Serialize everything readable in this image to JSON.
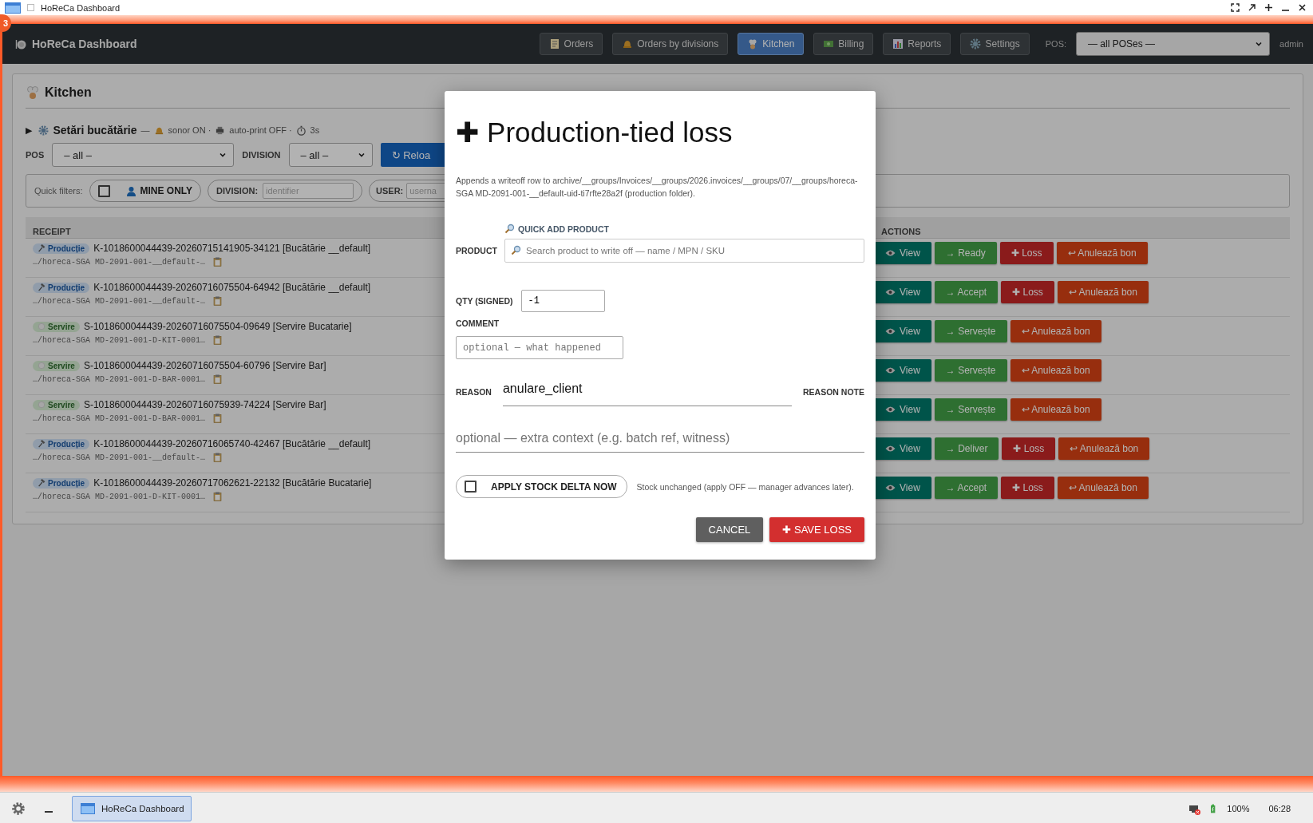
{
  "window": {
    "title": "HoReCa Dashboard",
    "badge": "3"
  },
  "header": {
    "title": "HoReCa Dashboard",
    "nav": [
      {
        "kind": "orders",
        "label": "Orders",
        "selected": false
      },
      {
        "kind": "divisions",
        "label": "Orders by divisions",
        "selected": false
      },
      {
        "kind": "kitchen",
        "label": "Kitchen",
        "selected": true
      },
      {
        "kind": "billing",
        "label": "Billing",
        "selected": false
      },
      {
        "kind": "reports",
        "label": "Reports",
        "selected": false
      },
      {
        "kind": "settings",
        "label": "Settings",
        "selected": false
      }
    ],
    "pos_label": "POS:",
    "pos_value": "— all POSes —",
    "user": "admin"
  },
  "kitchen": {
    "title": "Kitchen",
    "settings": {
      "toggle": "▶",
      "title": "Setări bucătărie",
      "separator": "—",
      "sound": "sonor ON ·",
      "autoprint": "auto-print OFF ·",
      "interval": "3s"
    },
    "filters": {
      "pos_label": "POS",
      "pos_value": "– all –",
      "division_label": "DIVISION",
      "division_value": "– all –",
      "reload": "↻ Reloa"
    },
    "quick_filters": {
      "label": "Quick filters:",
      "mine_only": {
        "label": "MINE ONLY",
        "checked": false
      },
      "division": {
        "label": "DIVISION:",
        "placeholder": "identifier"
      },
      "user": {
        "label": "USER:",
        "placeholder": "userna"
      }
    },
    "table": {
      "columns": [
        "RECEIPT",
        "ACTIONS"
      ],
      "rows": [
        {
          "badge": {
            "kind": "production",
            "label": "Producție"
          },
          "title": "K-1018600044439-20260715141905-34121 [Bucătărie __default]",
          "path": "…/horeca-SGA MD-2091-001-__default-…",
          "actions": [
            {
              "kind": "view",
              "label": "View"
            },
            {
              "kind": "advance",
              "label": "→ Ready"
            },
            {
              "kind": "loss",
              "label": "✚ Loss"
            },
            {
              "kind": "cancel",
              "label": "↩ Anulează bon"
            }
          ]
        },
        {
          "badge": {
            "kind": "production",
            "label": "Producție"
          },
          "title": "K-1018600044439-20260716075504-64942 [Bucătărie __default]",
          "path": "…/horeca-SGA MD-2091-001-__default-…",
          "actions": [
            {
              "kind": "view",
              "label": "View"
            },
            {
              "kind": "advance",
              "label": "→ Accept"
            },
            {
              "kind": "loss",
              "label": "✚ Loss"
            },
            {
              "kind": "cancel",
              "label": "↩ Anulează bon"
            }
          ]
        },
        {
          "badge": {
            "kind": "serving",
            "label": "Servire"
          },
          "title": "S-1018600044439-20260716075504-09649 [Servire Bucatarie]",
          "path": "…/horeca-SGA MD-2091-001-D-KIT-0001…",
          "actions": [
            {
              "kind": "view",
              "label": "View"
            },
            {
              "kind": "advance",
              "label": "→ Servește"
            },
            {
              "kind": "cancel",
              "label": "↩ Anulează bon"
            }
          ]
        },
        {
          "badge": {
            "kind": "serving",
            "label": "Servire"
          },
          "title": "S-1018600044439-20260716075504-60796 [Servire Bar]",
          "path": "…/horeca-SGA MD-2091-001-D-BAR-0001…",
          "actions": [
            {
              "kind": "view",
              "label": "View"
            },
            {
              "kind": "advance",
              "label": "→ Servește"
            },
            {
              "kind": "cancel",
              "label": "↩ Anulează bon"
            }
          ]
        },
        {
          "badge": {
            "kind": "serving",
            "label": "Servire"
          },
          "title": "S-1018600044439-20260716075939-74224 [Servire Bar]",
          "path": "…/horeca-SGA MD-2091-001-D-BAR-0001…",
          "actions": [
            {
              "kind": "view",
              "label": "View"
            },
            {
              "kind": "advance",
              "label": "→ Servește"
            },
            {
              "kind": "cancel",
              "label": "↩ Anulează bon"
            }
          ]
        },
        {
          "badge": {
            "kind": "production",
            "label": "Producție"
          },
          "title": "K-1018600044439-20260716065740-42467 [Bucătărie __default]",
          "path": "…/horeca-SGA MD-2091-001-__default-…",
          "actions": [
            {
              "kind": "view",
              "label": "View"
            },
            {
              "kind": "advance",
              "label": "→ Deliver"
            },
            {
              "kind": "loss",
              "label": "✚ Loss"
            },
            {
              "kind": "cancel",
              "label": "↩ Anulează bon"
            }
          ]
        },
        {
          "badge": {
            "kind": "production",
            "label": "Producție"
          },
          "title": "K-1018600044439-20260717062621-22132 [Bucătărie Bucatarie]",
          "path": "…/horeca-SGA MD-2091-001-D-KIT-0001…",
          "actions": [
            {
              "kind": "view",
              "label": "View"
            },
            {
              "kind": "advance",
              "label": "→ Accept"
            },
            {
              "kind": "loss",
              "label": "✚ Loss"
            },
            {
              "kind": "cancel",
              "label": "↩ Anulează bon"
            }
          ]
        }
      ]
    }
  },
  "dialog": {
    "title": "✚ Production-tied loss",
    "description": "Appends a writeoff row to archive/__groups/Invoices/__groups/2026.invoices/__groups/07/__groups/horeca-SGA MD-2091-001-__default-uid-ti7rfte28a2f (production folder).",
    "quick_add": "QUICK ADD PRODUCT",
    "product_label": "PRODUCT",
    "product_placeholder": "Search product to write off — name / MPN / SKU",
    "qty_label": "QTY (SIGNED)",
    "qty_value": "-1",
    "comment_label": "COMMENT",
    "comment_placeholder": "optional — what happened",
    "reason_label": "REASON",
    "reason_value": "anulare_client",
    "reason_note_label": "REASON NOTE",
    "reason_note_placeholder": "optional — extra context (e.g. batch ref, witness)",
    "apply": {
      "label": "APPLY STOCK DELTA NOW",
      "checked": false
    },
    "apply_note": "Stock unchanged (apply OFF — manager advances later).",
    "buttons": [
      {
        "kind": "cancel",
        "label": "CANCEL"
      },
      {
        "kind": "save",
        "label": "✚ SAVE LOSS"
      }
    ]
  },
  "taskbar": {
    "task": {
      "label": "HoReCa Dashboard",
      "selected": true
    },
    "battery": "100%",
    "clock": "06:28"
  }
}
